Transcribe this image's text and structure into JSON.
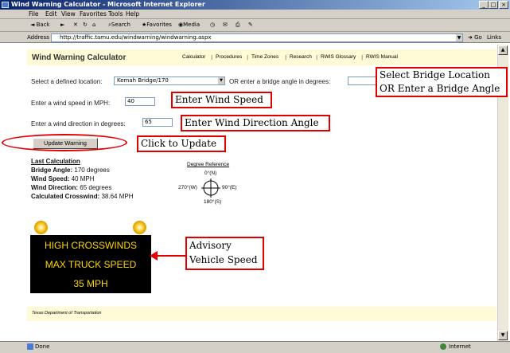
{
  "window": {
    "title": "Wind Warning Calculator - Microsoft Internet Explorer",
    "buttons": [
      "_",
      "□",
      "×"
    ]
  },
  "menu": [
    "File",
    "Edit",
    "View",
    "Favorites",
    "Tools",
    "Help"
  ],
  "toolbar": [
    "Back",
    "Search",
    "Favorites",
    "Media"
  ],
  "address": {
    "label": "Address",
    "url": "http://traffic.tamu.edu/windwarning/windwarning.aspx",
    "go": "Go",
    "links": "Links"
  },
  "page": {
    "title": "Wind Warning Calculator",
    "nav": [
      "Calculator",
      "Procedures",
      "Time Zones",
      "Research",
      "RWIS Glossary",
      "RWIS Manual"
    ],
    "location_label": "Select a defined location:",
    "location_value": "Kemah Bridge/170",
    "or_label": "OR enter a bridge angle in degrees:",
    "wind_speed_label": "Enter a wind speed in MPH:",
    "wind_speed_value": "40",
    "wind_dir_label": "Enter a wind direction in degrees:",
    "wind_dir_value": "65",
    "update_button": "Update Warning",
    "last_calc": {
      "heading": "Last Calculation",
      "bridge_angle_label": "Bridge Angle:",
      "bridge_angle_value": "170 degrees",
      "wind_speed_label": "Wind Speed:",
      "wind_speed_value": "40 MPH",
      "wind_dir_label": "Wind Direction:",
      "wind_dir_value": "65 degrees",
      "crosswind_label": "Calculated Crosswind:",
      "crosswind_value": "38.64 MPH"
    },
    "degree_ref": {
      "title": "Degree Reference",
      "north": "0°(N)",
      "east": "90°(E)",
      "south": "180°(S)",
      "west": "270°(W)"
    },
    "sign": {
      "line1": "HIGH CROSSWINDS",
      "line2": "MAX TRUCK SPEED",
      "line3": "35 MPH",
      "text_color": "#ffd700"
    },
    "footer": "Texas Department of Transportation"
  },
  "status": {
    "done": "Done",
    "zone": "Internet"
  },
  "annotations": {
    "select_bridge_1": "Select Bridge Location",
    "select_bridge_2": "OR Enter a Bridge Angle",
    "wind_speed": "Enter Wind Speed",
    "wind_dir": "Enter Wind Direction Angle",
    "update": "Click to Update",
    "advisory_1": "Advisory",
    "advisory_2": "Vehicle Speed",
    "color": "#e00000"
  }
}
